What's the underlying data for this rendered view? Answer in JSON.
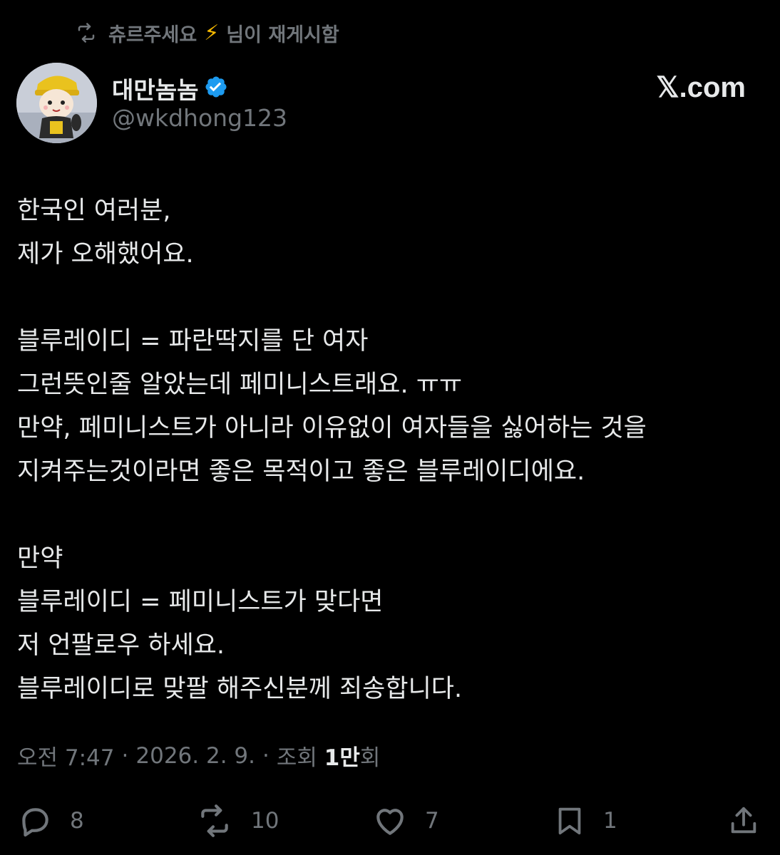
{
  "retweet": {
    "user": "츄르주세요",
    "suffix": "님이 재게시함"
  },
  "author": {
    "name": "대만놈놈",
    "handle": "@wkdhong123",
    "verified": true,
    "verified_color": "#1d9bf0"
  },
  "brand": "𝕏.com",
  "tweet": {
    "lines": [
      "한국인 여러분,",
      "제가 오해했어요.",
      "",
      "블루레이디 = 파란딱지를 단 여자",
      "그런뜻인줄 알았는데 페미니스트래요. ㅠㅠ",
      "만약, 페미니스트가 아니라 이유없이 여자들을 싫어하는 것을",
      "지켜주는것이라면 좋은 목적이고 좋은 블루레이디에요.",
      "",
      "만약",
      "블루레이디 = 페미니스트가 맞다면",
      "저 언팔로우 하세요.",
      "블루레이디로 맞팔 해주신분께 죄송합니다."
    ]
  },
  "meta": {
    "time": "오전 7:47",
    "date": "2026. 2. 9.",
    "views_label_prefix": "조회",
    "views_count": "1만",
    "views_suffix": "회",
    "separator": "·"
  },
  "actions": {
    "reply_count": "8",
    "repost_count": "10",
    "like_count": "7",
    "bookmark_count": "1"
  },
  "colors": {
    "background": "#000000",
    "text": "#e7e9ea",
    "muted": "#71767b",
    "accent": "#1d9bf0"
  }
}
